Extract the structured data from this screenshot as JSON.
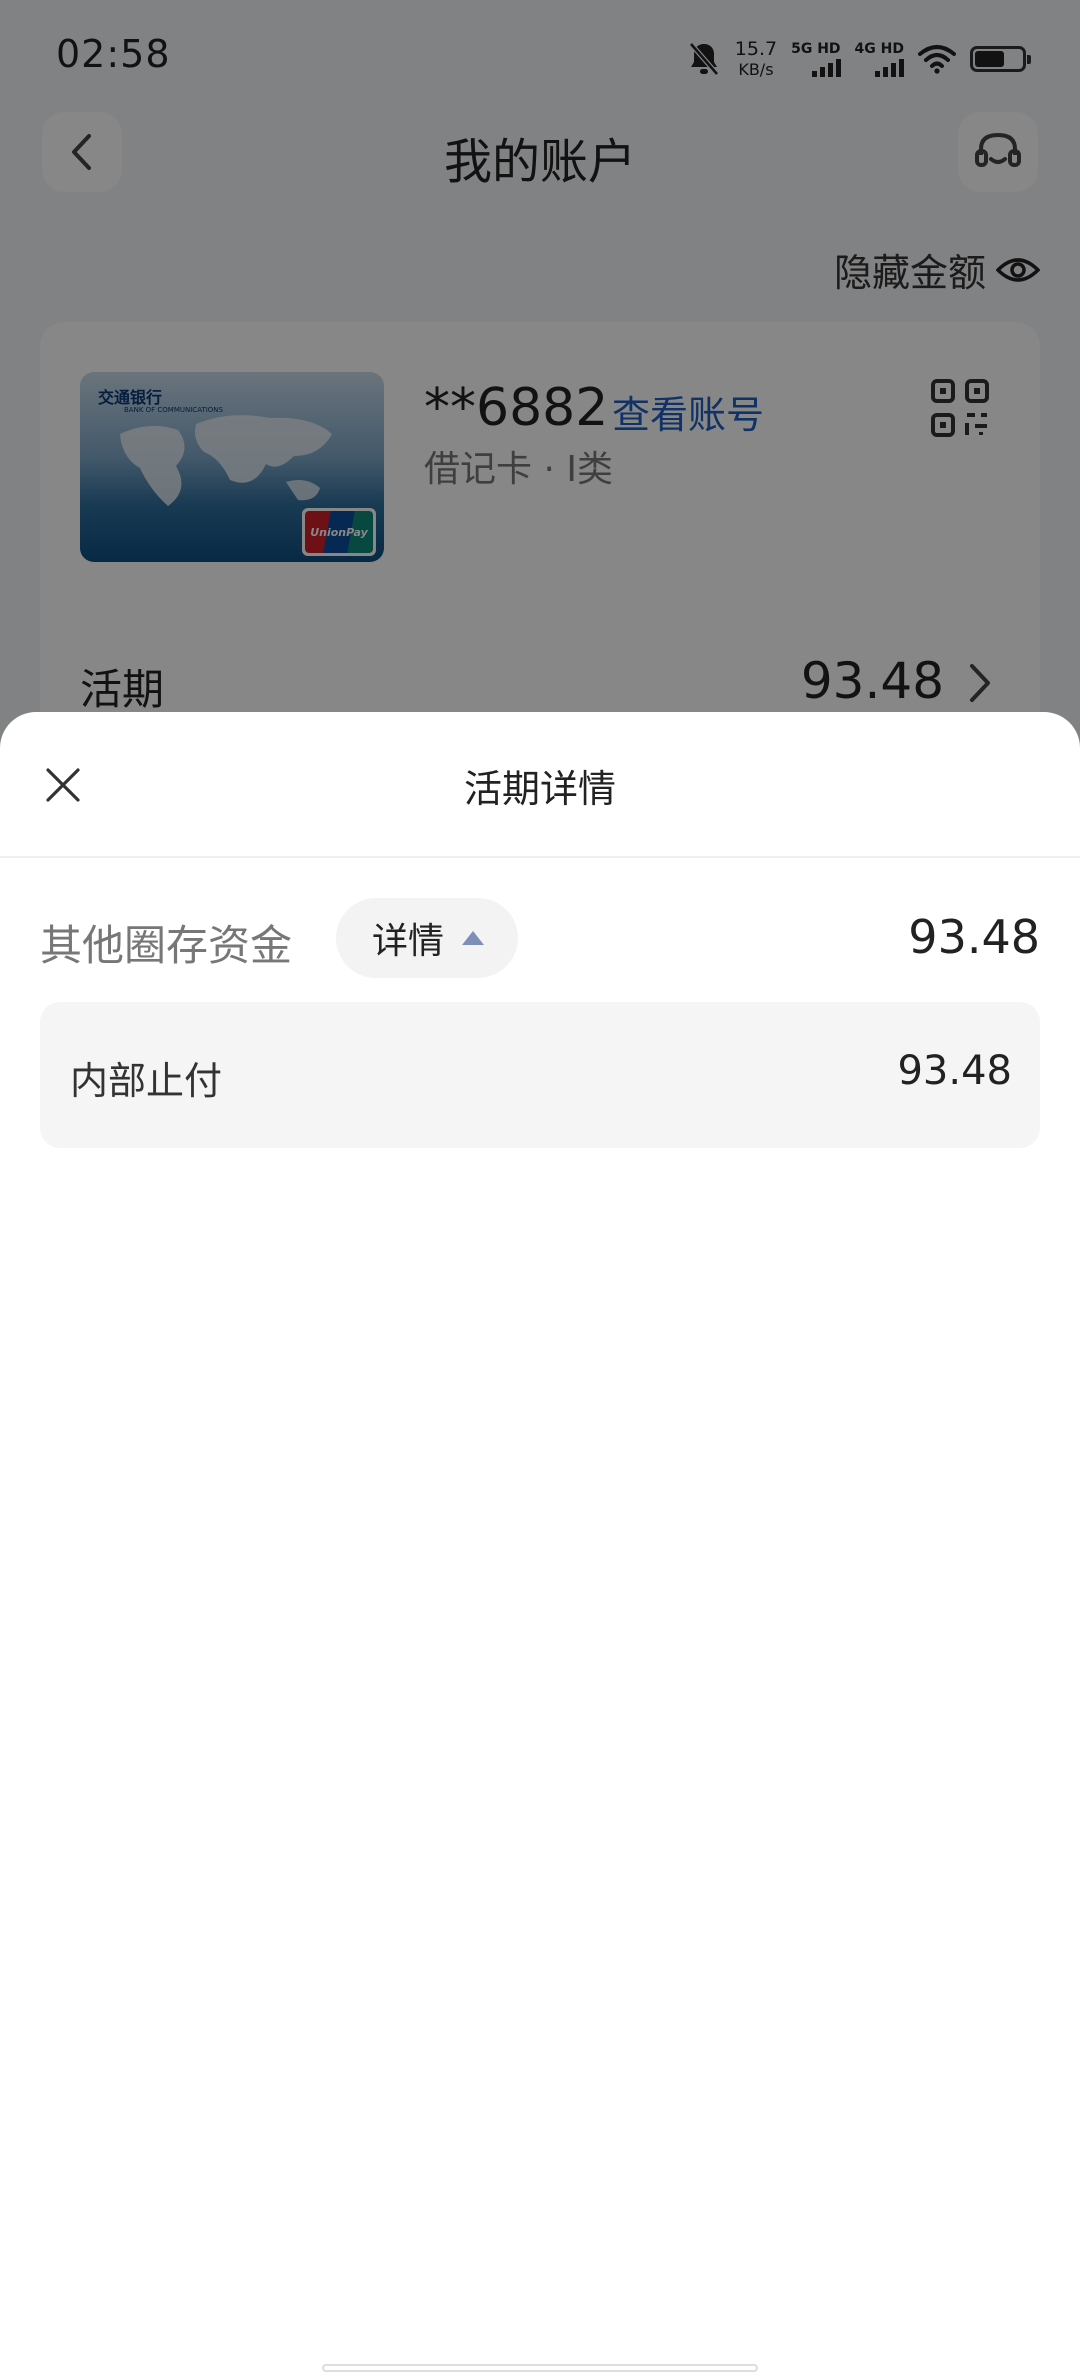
{
  "status_bar": {
    "time": "02:58",
    "net_speed_value": "15.7",
    "net_speed_unit": "KB/s",
    "sim1_label": "5G HD",
    "sim2_label": "4G HD"
  },
  "nav": {
    "title": "我的账户"
  },
  "hide_amount_label": "隐藏金额",
  "account": {
    "bank_name": "交通银行",
    "bank_name_en": "BANK OF COMMUNICATIONS",
    "unionpay_label": "UnionPay",
    "card_number": "**6882",
    "view_account_label": "查看账号",
    "card_type": "借记卡 · I类",
    "current_label": "活期",
    "current_amount": "93.48"
  },
  "sheet": {
    "title": "活期详情",
    "fund_label": "其他圈存资金",
    "detail_toggle_label": "详情",
    "fund_amount": "93.48",
    "items": [
      {
        "label": "内部止付",
        "amount": "93.48"
      }
    ]
  },
  "colors": {
    "link_blue": "#1f5fc2",
    "caret": "#7d8fb8",
    "overlay": "rgba(0,0,0,0.47)"
  }
}
